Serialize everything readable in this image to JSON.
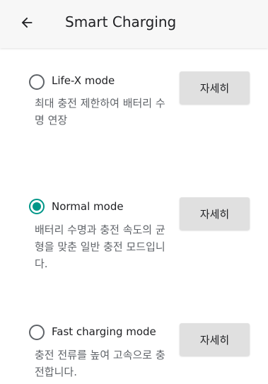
{
  "appbar": {
    "back_icon": "arrow-left-icon",
    "title": "Smart Charging"
  },
  "accent_color": "#009688",
  "options": [
    {
      "label": "Life-X mode",
      "selected": false,
      "description": "최대 충전 제한하여 배터리 수명 연장",
      "detail_button": "자세히"
    },
    {
      "label": "Normal mode",
      "selected": true,
      "description": "배터리 수명과 충전 속도의 균형을 맞춘 일반 충전 모드입니다.",
      "detail_button": "자세히"
    },
    {
      "label": "Fast charging mode",
      "selected": false,
      "description": "충전 전류를 높여 고속으로 충전합니다.",
      "detail_button": "자세히"
    }
  ]
}
